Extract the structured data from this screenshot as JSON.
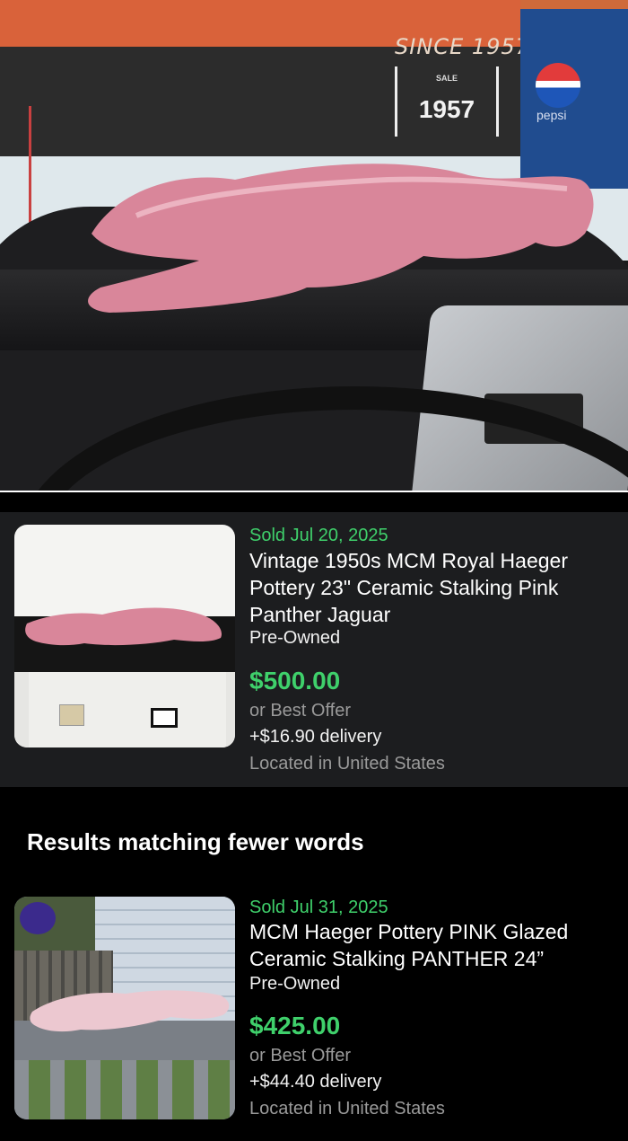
{
  "photo": {
    "sign_since": "SINCE 1957",
    "sign_small": "SALE",
    "sign_year": "1957",
    "brand_text": "pepsi"
  },
  "listings": [
    {
      "sold_label": "Sold  Jul 20, 2025",
      "title": "Vintage 1950s MCM Royal Haeger Pottery 23\" Ceramic Stalking Pink Panther Jaguar",
      "condition": "Pre-Owned",
      "price": "$500.00",
      "offer": "or Best Offer",
      "delivery": "+$16.90 delivery",
      "location": "Located in United States"
    },
    {
      "sold_label": "Sold  Jul 31, 2025",
      "title": "MCM Haeger Pottery PINK Glazed Ceramic Stalking PANTHER  24”",
      "condition": "Pre-Owned",
      "price": "$425.00",
      "offer": "or Best Offer",
      "delivery": "+$44.40 delivery",
      "location": "Located in United States"
    }
  ],
  "section": {
    "heading": "Results matching fewer words"
  },
  "colors": {
    "accent_green": "#3fd06b",
    "card_bg": "#1c1d1f",
    "panther_pink": "#d9869a"
  }
}
